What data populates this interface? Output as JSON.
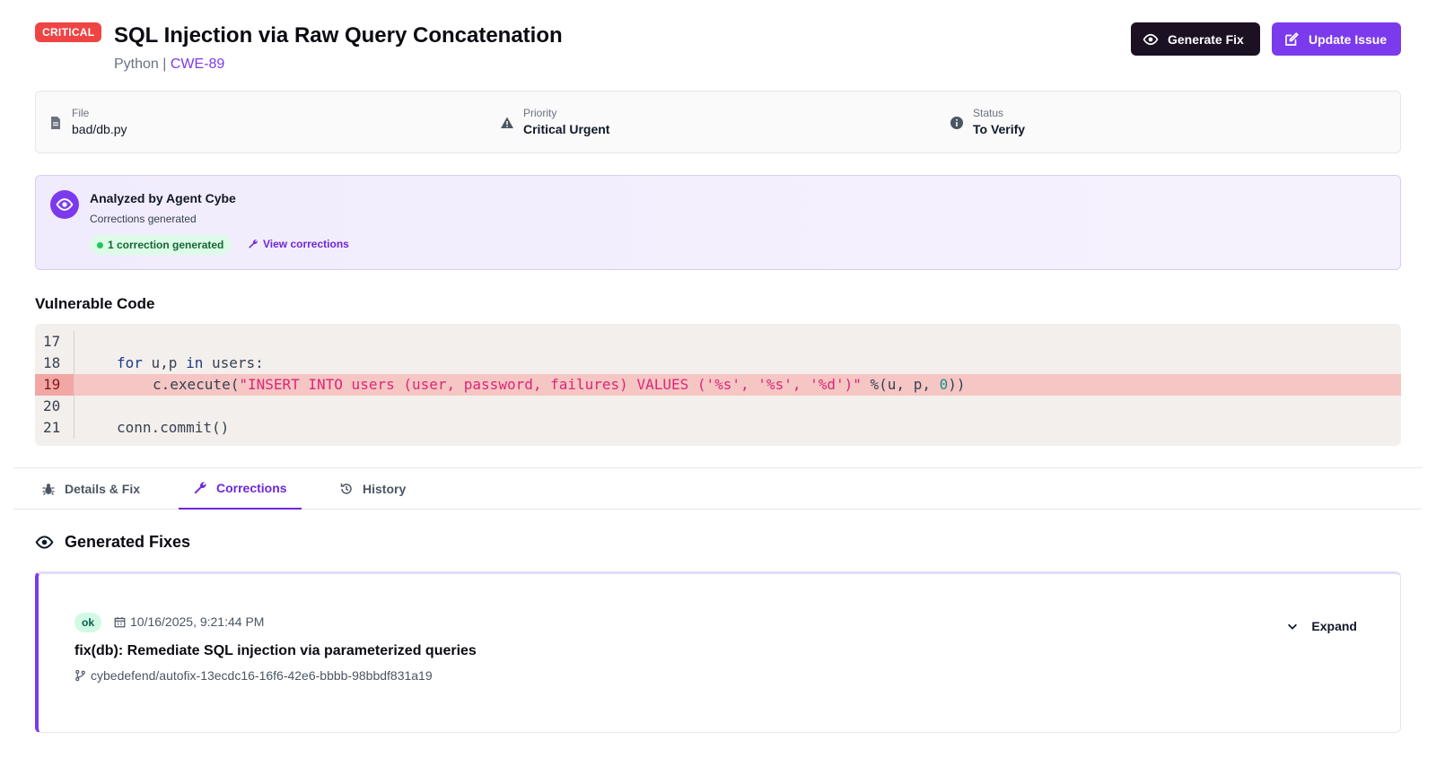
{
  "header": {
    "severity": "CRITICAL",
    "title": "SQL Injection via Raw Query Concatenation",
    "language": "Python",
    "separator": "|",
    "cwe": "CWE-89",
    "generate_fix_label": "Generate Fix",
    "update_issue_label": "Update Issue"
  },
  "meta": {
    "file_label": "File",
    "file_value": "bad/db.py",
    "priority_label": "Priority",
    "priority_value": "Critical Urgent",
    "status_label": "Status",
    "status_value": "To Verify"
  },
  "agent": {
    "title": "Analyzed by Agent Cybe",
    "subtitle": "Corrections generated",
    "pill": "1 correction generated",
    "link": "View corrections"
  },
  "code": {
    "title": "Vulnerable Code",
    "lines": [
      {
        "num": "17",
        "text": ""
      },
      {
        "num": "18",
        "text": "for u,p in users:"
      },
      {
        "num": "19",
        "text": "c.execute(\"INSERT INTO users (user, password, failures) VALUES ('%s', '%s', '%d')\" %(u, p, 0))",
        "highlight": true
      },
      {
        "num": "20",
        "text": ""
      },
      {
        "num": "21",
        "text": "conn.commit()"
      }
    ]
  },
  "tabs": [
    {
      "label": "Details & Fix",
      "icon": "bug-icon"
    },
    {
      "label": "Corrections",
      "icon": "wrench-icon",
      "active": true
    },
    {
      "label": "History",
      "icon": "history-icon"
    }
  ],
  "fixes": {
    "title": "Generated Fixes",
    "items": [
      {
        "status": "ok",
        "date": "10/16/2025, 9:21:44 PM",
        "title": "fix(db): Remediate SQL injection via parameterized queries",
        "branch": "cybedefend/autofix-13ecdc16-16f6-42e6-bbbb-98bbdf831a19",
        "expand_label": "Expand"
      }
    ]
  },
  "colors": {
    "accent": "#7c3aed",
    "critical": "#ef4444",
    "dark_button": "#1c1123"
  }
}
